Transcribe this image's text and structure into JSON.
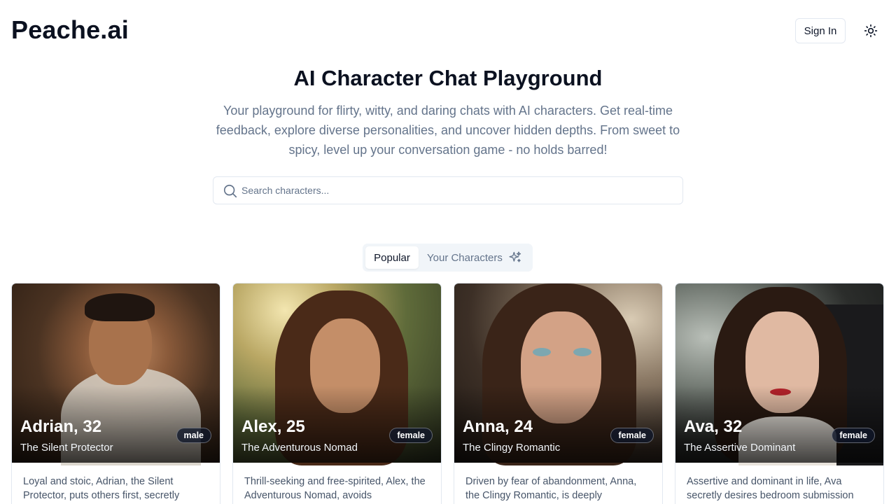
{
  "header": {
    "logo": "Peache.ai",
    "sign_in": "Sign In",
    "theme_icon": "sun-icon"
  },
  "hero": {
    "title": "AI Character Chat Playground",
    "subtitle": "Your playground for flirty, witty, and daring chats with AI characters. Get real-time feedback, explore diverse personalities, and uncover hidden depths. From sweet to spicy, level up your conversation game - no holds barred!"
  },
  "search": {
    "placeholder": "Search characters...",
    "value": "",
    "icon": "search-icon"
  },
  "tabs": {
    "popular": "Popular",
    "yours": "Your Characters",
    "yours_icon": "sparkles-icon"
  },
  "cards": [
    {
      "name": "Adrian, 32",
      "role": "The Silent Protector",
      "gender": "male",
      "desc": "Loyal and stoic, Adrian, the Silent Protector, puts others first, secretly"
    },
    {
      "name": "Alex, 25",
      "role": "The Adventurous Nomad",
      "gender": "female",
      "desc": "Thrill-seeking and free-spirited, Alex, the Adventurous Nomad, avoids"
    },
    {
      "name": "Anna, 24",
      "role": "The Clingy Romantic",
      "gender": "female",
      "desc": "Driven by fear of abandonment, Anna, the Clingy Romantic, is deeply"
    },
    {
      "name": "Ava, 32",
      "role": "The Assertive Dominant",
      "gender": "female",
      "desc": "Assertive and dominant in life, Ava secretly desires bedroom submission"
    }
  ]
}
